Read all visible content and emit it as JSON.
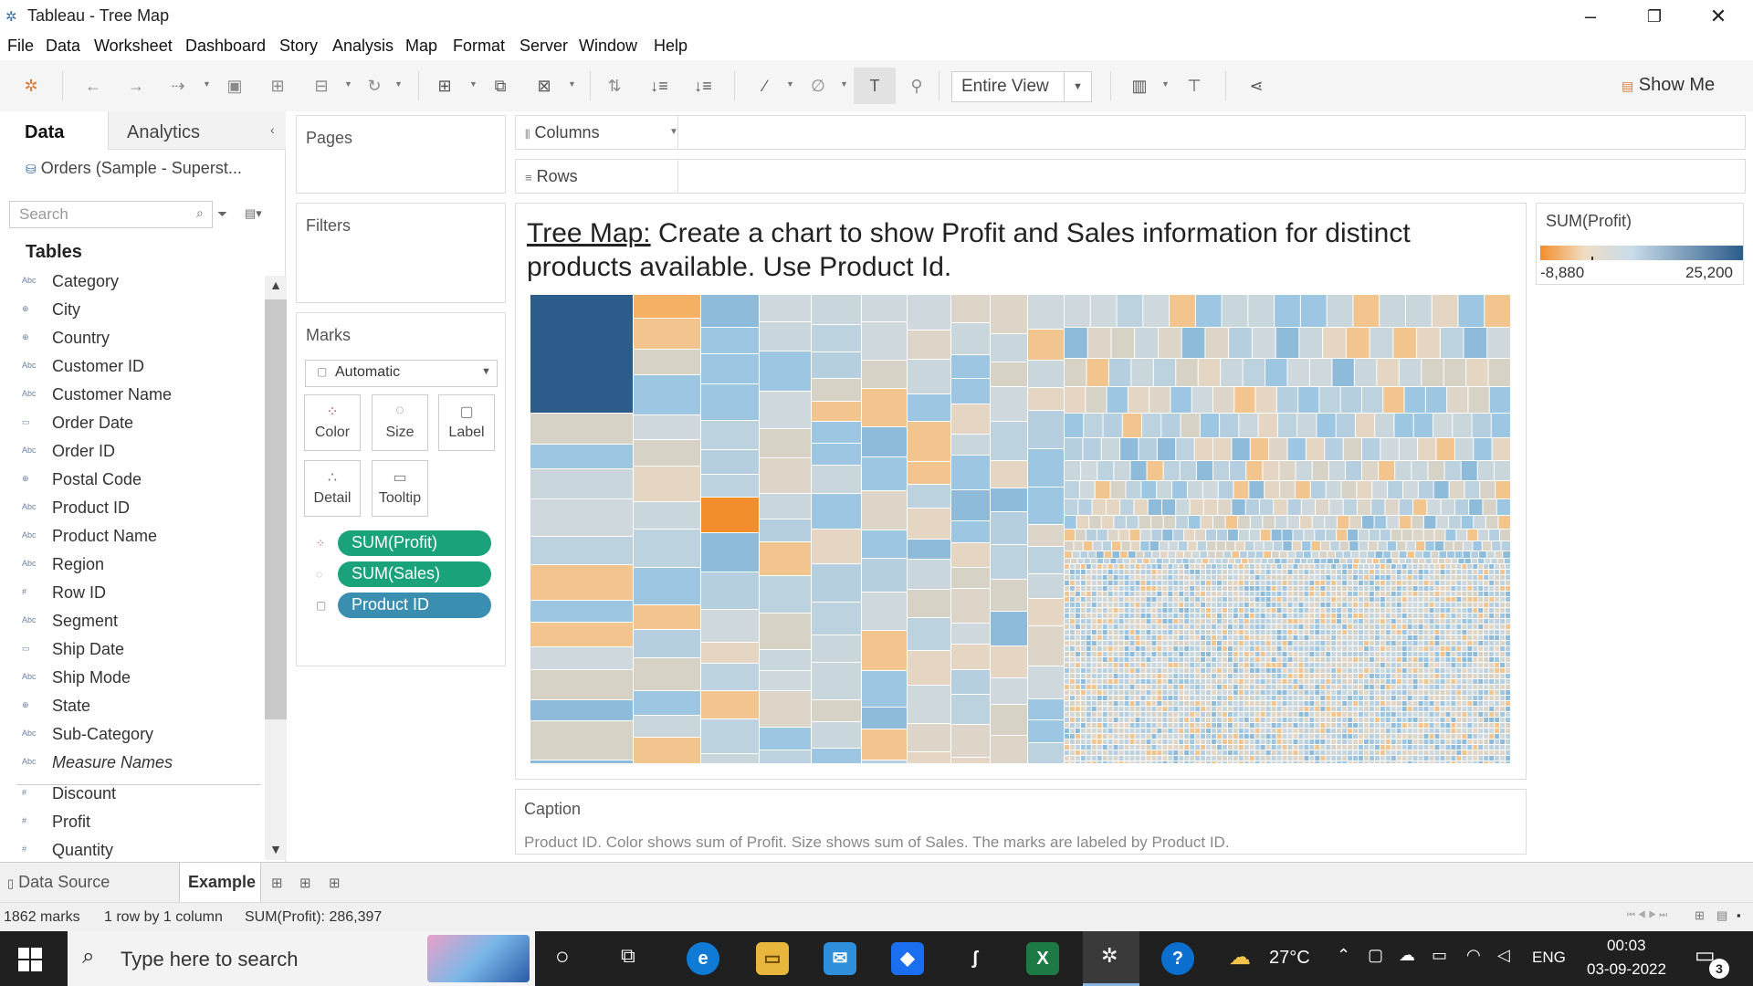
{
  "window": {
    "title": "Tableau - Tree Map"
  },
  "menu": [
    "File",
    "Data",
    "Worksheet",
    "Dashboard",
    "Story",
    "Analysis",
    "Map",
    "Format",
    "Server",
    "Window",
    "Help"
  ],
  "toolbar": {
    "fit": "Entire View",
    "show_me": "Show Me"
  },
  "left": {
    "tab_data": "Data",
    "tab_analytics": "Analytics",
    "datasource": "Orders (Sample - Superst...",
    "search_placeholder": "Search",
    "tables_heading": "Tables",
    "fields": [
      {
        "name": "Category",
        "icon": "Abc"
      },
      {
        "name": "City",
        "icon": "⊕"
      },
      {
        "name": "Country",
        "icon": "⊕"
      },
      {
        "name": "Customer ID",
        "icon": "Abc"
      },
      {
        "name": "Customer Name",
        "icon": "Abc"
      },
      {
        "name": "Order Date",
        "icon": "▭"
      },
      {
        "name": "Order ID",
        "icon": "Abc"
      },
      {
        "name": "Postal Code",
        "icon": "⊕"
      },
      {
        "name": "Product ID",
        "icon": "Abc"
      },
      {
        "name": "Product Name",
        "icon": "Abc"
      },
      {
        "name": "Region",
        "icon": "Abc"
      },
      {
        "name": "Row ID",
        "icon": "#"
      },
      {
        "name": "Segment",
        "icon": "Abc"
      },
      {
        "name": "Ship Date",
        "icon": "▭"
      },
      {
        "name": "Ship Mode",
        "icon": "Abc"
      },
      {
        "name": "State",
        "icon": "⊕"
      },
      {
        "name": "Sub-Category",
        "icon": "Abc"
      },
      {
        "name": "Measure Names",
        "icon": "Abc"
      }
    ],
    "measures": [
      {
        "name": "Discount",
        "icon": "#"
      },
      {
        "name": "Profit",
        "icon": "#"
      },
      {
        "name": "Quantity",
        "icon": "#"
      }
    ]
  },
  "cards": {
    "pages": "Pages",
    "filters": "Filters",
    "marks": "Marks",
    "mark_type": "Automatic",
    "buttons": [
      "Color",
      "Size",
      "Label",
      "Detail",
      "Tooltip"
    ],
    "pills": [
      {
        "label": "SUM(Profit)",
        "color": "#1aa37a"
      },
      {
        "label": "SUM(Sales)",
        "color": "#1aa37a"
      },
      {
        "label": "Product ID",
        "color": "#3a8fb0"
      }
    ]
  },
  "shelves": {
    "columns": "Columns",
    "rows": "Rows"
  },
  "viz": {
    "title_underlined": "Tree Map:",
    "title_rest": " Create a chart to show Profit and Sales information for distinct products available. Use Product Id."
  },
  "legend": {
    "title": "SUM(Profit)",
    "min": "-8,880",
    "max": "25,200",
    "colors": [
      "#f28e2b",
      "#f0ddc4",
      "#c9dcea",
      "#2b5c8a"
    ]
  },
  "caption": {
    "title": "Caption",
    "text": "Product ID.  Color shows sum of Profit.  Size shows sum of Sales.  The marks are labeled by Product ID."
  },
  "sheettabs": {
    "datasource": "Data Source",
    "sheet": "Example"
  },
  "status": {
    "marks": "1862 marks",
    "dims": "1 row by 1 column",
    "sum": "SUM(Profit): 286,397"
  },
  "taskbar": {
    "search": "Type here to search",
    "weather": "27°C",
    "lang": "ENG",
    "time": "00:03",
    "date": "03-09-2022",
    "notif": "3"
  }
}
